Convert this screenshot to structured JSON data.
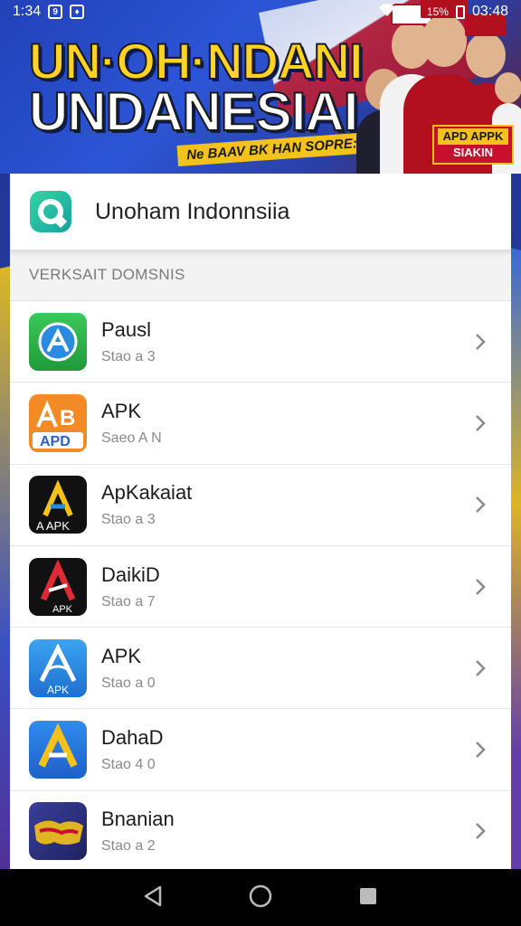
{
  "status_bar": {
    "time": "1:34",
    "badge1": "9",
    "badge2": "♦",
    "battery_text": "15%",
    "clock_right": "03:48"
  },
  "banner": {
    "title_line1": "UN·OH·NDANI",
    "title_line2": "UNDANESIAI",
    "tagline": "Ne BAAV BK HAN SOPRE: SIADE",
    "badge_line1": "APD APPK",
    "badge_line2": "SIAKIN"
  },
  "header": {
    "title": "Unoham Indonnsiia",
    "logo_icon": "chat-bubble-icon"
  },
  "section": {
    "title": "VERKSAIT DOMSNIS"
  },
  "apps": [
    {
      "name": "Pausl",
      "subtitle": "Stao a 3",
      "icon": "app-store-a-icon",
      "color": "#2fb34a"
    },
    {
      "name": "APK",
      "subtitle": "Saeo A N",
      "icon": "apk-a-icon",
      "color": "#f28b25"
    },
    {
      "name": "ApKakaiat",
      "subtitle": "Stao a 3",
      "icon": "triangle-a-icon",
      "color": "#111111"
    },
    {
      "name": "DaikiD",
      "subtitle": "Stao a 7",
      "icon": "red-a-icon",
      "color": "#111111"
    },
    {
      "name": "APK",
      "subtitle": "Stao a 0",
      "icon": "blue-a-icon",
      "color": "#2a8be0"
    },
    {
      "name": "DahaD",
      "subtitle": "Stao 4 0",
      "icon": "yellow-a-icon",
      "color": "#2a7fe0"
    },
    {
      "name": "Bnanian",
      "subtitle": "Stao a 2",
      "icon": "game-logo-icon",
      "color": "#2d2f6e"
    }
  ],
  "nav": {
    "back_icon": "back-triangle-icon",
    "home_icon": "home-circle-icon",
    "recents_icon": "recents-square-icon"
  }
}
